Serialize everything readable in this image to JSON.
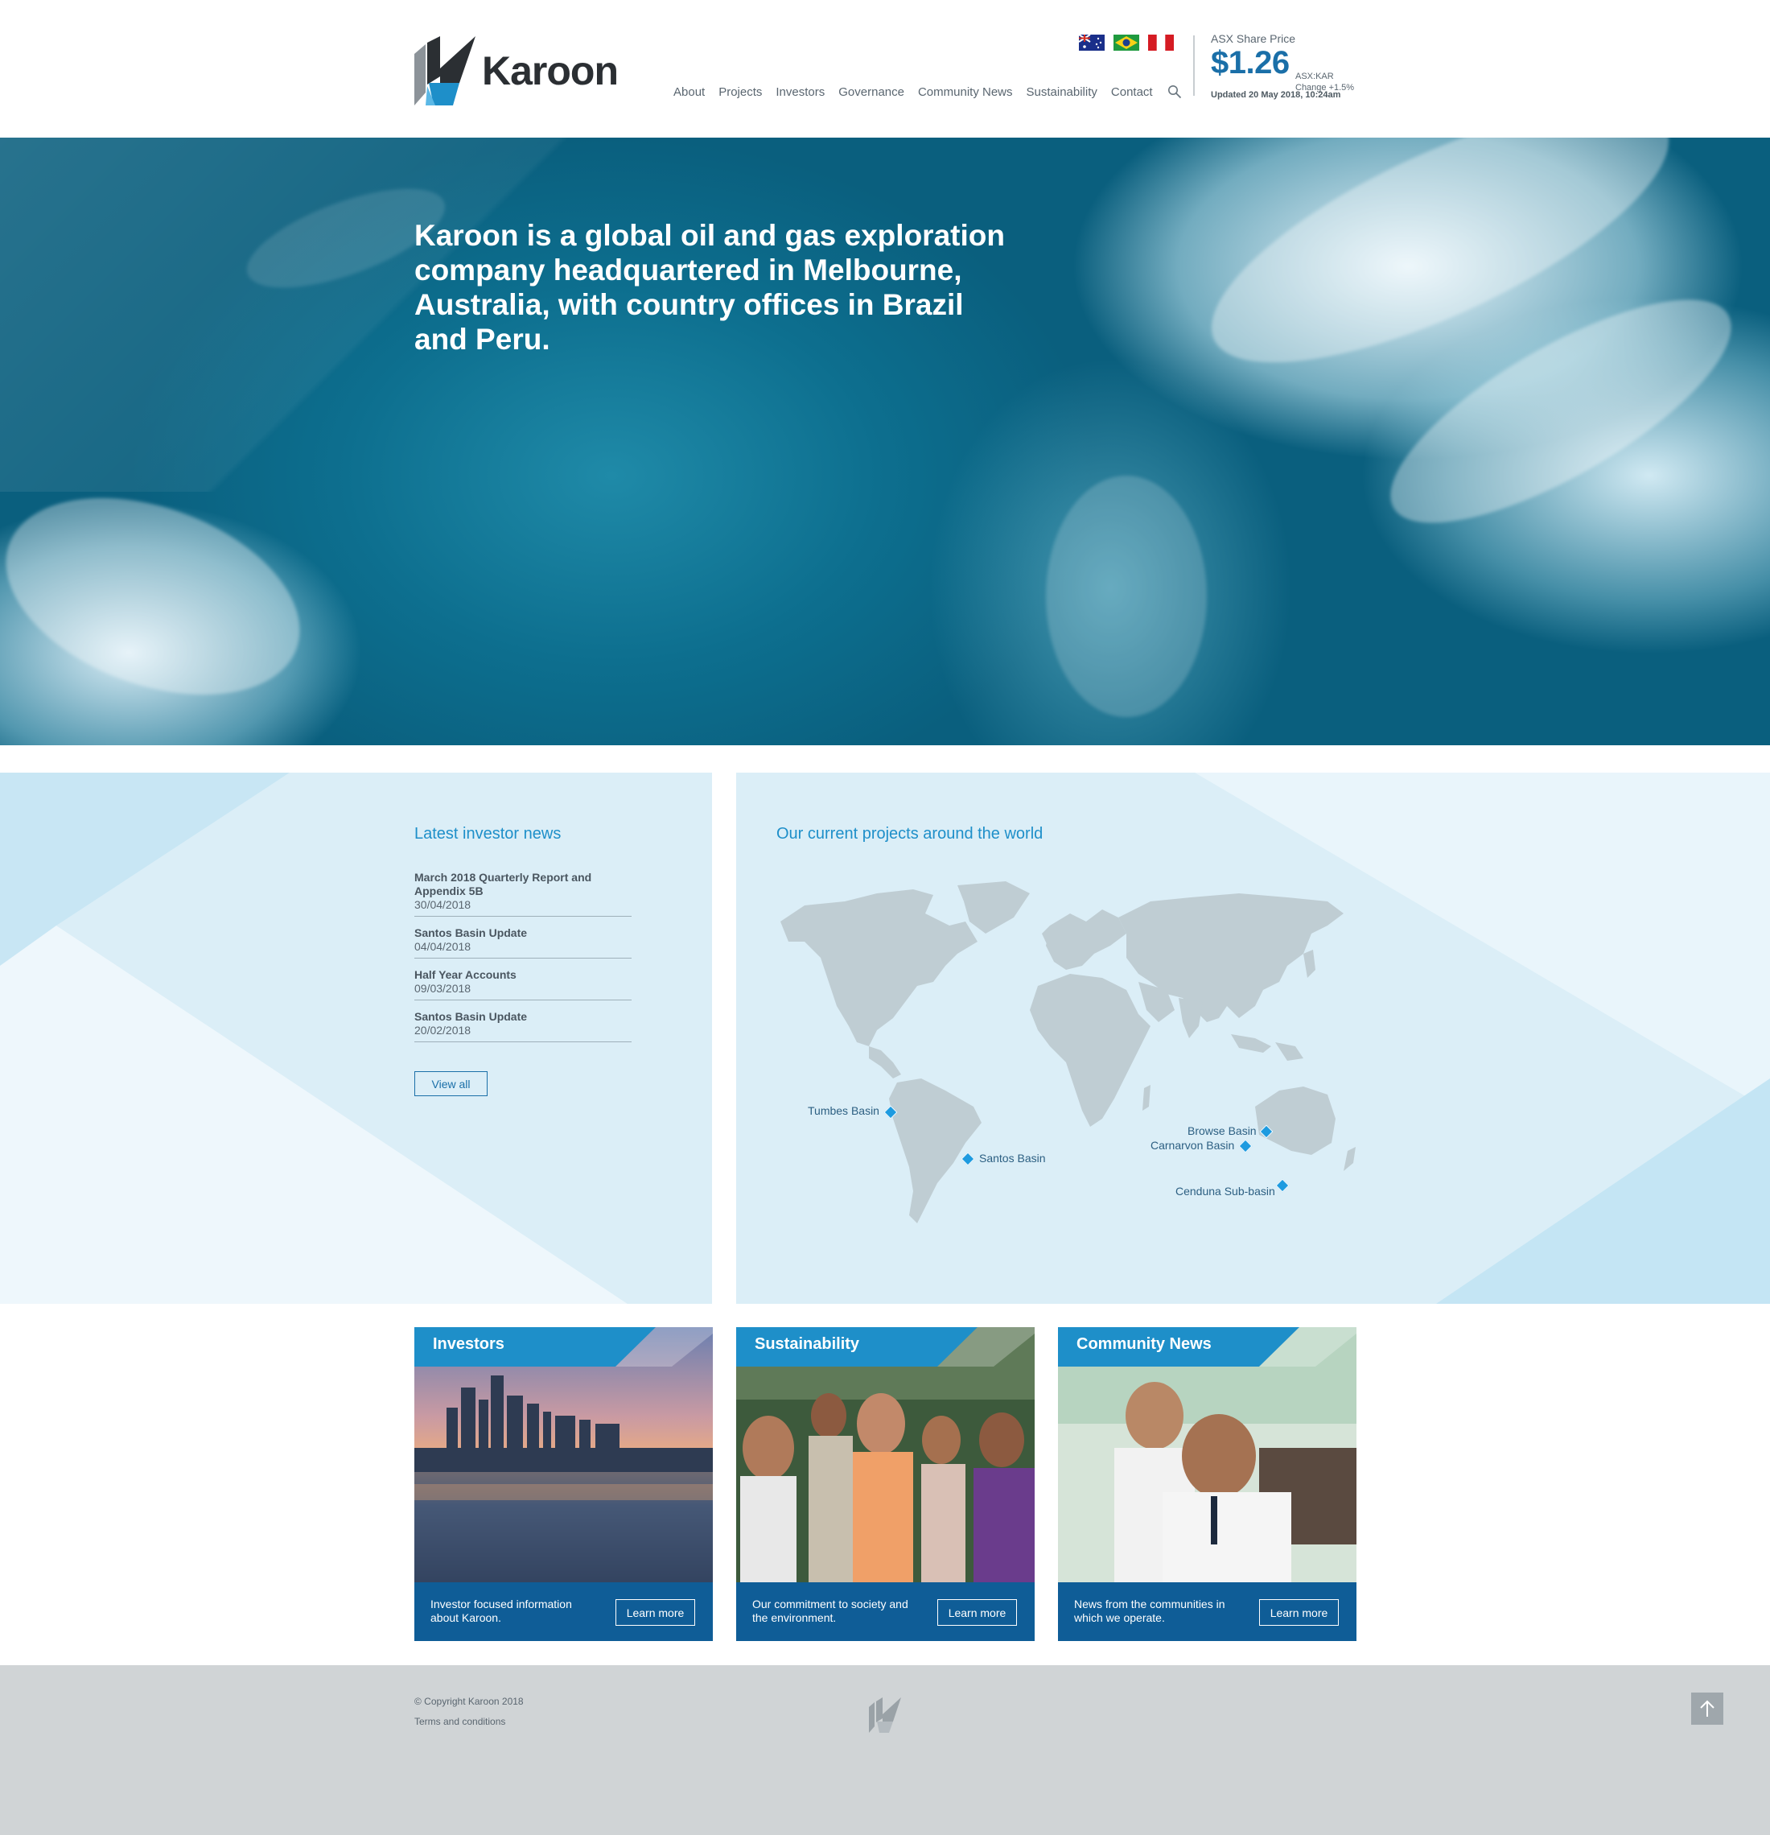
{
  "brand": {
    "name": "Karoon",
    "accent": "#1e8fc9",
    "dark_blue": "#0f5d97"
  },
  "header": {
    "flags": [
      "australia-flag",
      "brazil-flag",
      "peru-flag"
    ],
    "nav": [
      "About",
      "Projects",
      "Investors",
      "Governance",
      "Community News",
      "Sustainability",
      "Contact"
    ]
  },
  "share": {
    "title": "ASX Share Price",
    "price": "$1.26",
    "code": "ASX:KAR",
    "change": "Change +1.5%",
    "updated": "Updated 20 May 2018, 10:24am"
  },
  "hero": {
    "text": "Karoon is a global oil and gas exploration company headquartered in Melbourne, Australia, with country offices in Brazil and Peru."
  },
  "news": {
    "heading": "Latest investor news",
    "items": [
      {
        "title": "March 2018 Quarterly Report and Appendix 5B",
        "date": "30/04/2018"
      },
      {
        "title": "Santos Basin Update",
        "date": "04/04/2018"
      },
      {
        "title": "Half Year Accounts",
        "date": "09/03/2018"
      },
      {
        "title": "Santos Basin Update",
        "date": "20/02/2018"
      }
    ],
    "view_all": "View all"
  },
  "map": {
    "heading": "Our current projects around the world",
    "pins": [
      "Tumbes Basin",
      "Santos Basin",
      "Browse Basin",
      "Carnarvon Basin",
      "Cenduna Sub-basin"
    ]
  },
  "cards": [
    {
      "title": "Investors",
      "desc": "Investor focused information about Karoon.",
      "button": "Learn more"
    },
    {
      "title": "Sustainability",
      "desc": "Our commitment to society and the environment.",
      "button": "Learn more"
    },
    {
      "title": "Community News",
      "desc": "News from the communities in which we operate.",
      "button": "Learn more"
    }
  ],
  "footer": {
    "copyright": "© Copyright Karoon 2018",
    "terms": "Terms and conditions"
  }
}
